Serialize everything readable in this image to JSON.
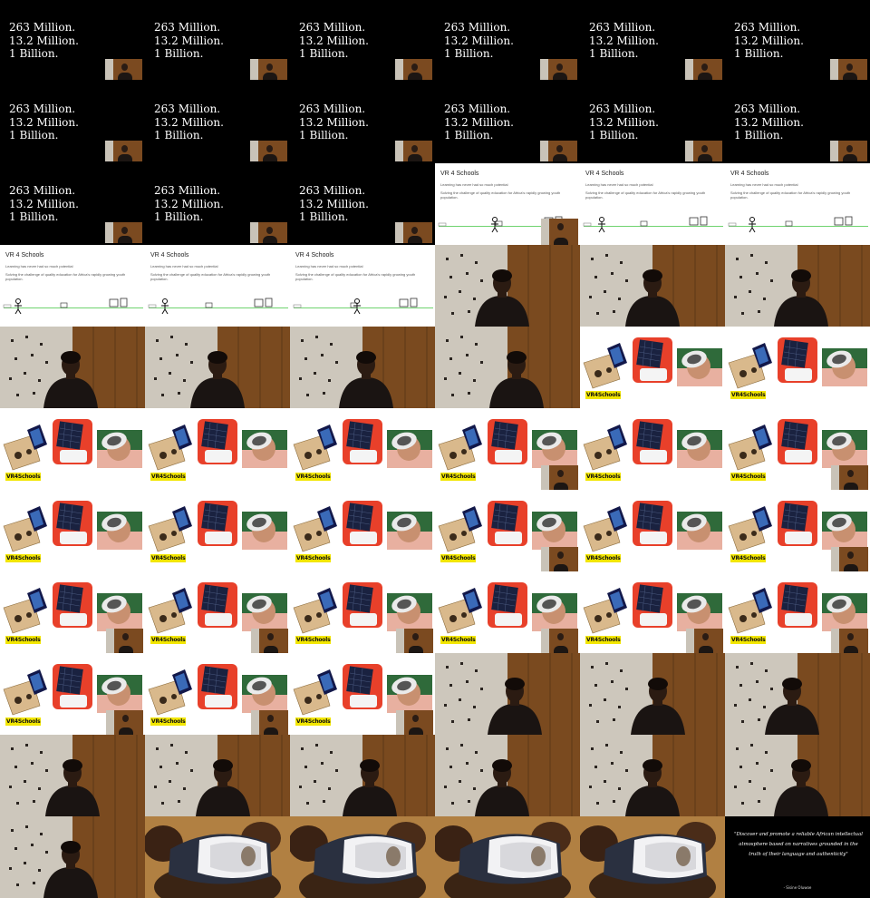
{
  "stats_slide": {
    "lines": [
      "263 Million.",
      "13.2 Million.",
      "1 Billion."
    ]
  },
  "vr_slide": {
    "title": "VR 4 Schools",
    "subtitle": "Learning has never had so much potential",
    "body": "Solving the challenge of quality education for Africa's rapidly growing youth population."
  },
  "product_slide": {
    "tag": "VR4Schools"
  },
  "quote_slide": {
    "quote": "\"Discover and promote a reliable African intellectual atmosphere based on narratives grounded in the truth of their language and authenticity\"",
    "attribution": "- Sisine Oluwoe"
  },
  "colors": {
    "stats_bg": "#000000",
    "vr_line": "#6fd36f",
    "tag_yellow": "#f2e600",
    "wood": "#7a4a1f",
    "wall": "#cdc7bc"
  },
  "frames": [
    "stats",
    "stats",
    "stats",
    "stats",
    "stats",
    "stats",
    "stats",
    "stats",
    "stats",
    "stats",
    "stats",
    "stats",
    "stats",
    "stats",
    "stats",
    "vr",
    "vr",
    "vr",
    "vr",
    "vr",
    "vr",
    "speaker",
    "speaker",
    "speaker",
    "speaker",
    "speaker",
    "speaker",
    "speaker",
    "products",
    "products",
    "products",
    "products",
    "products",
    "products",
    "products",
    "products",
    "products",
    "products",
    "products",
    "products",
    "products",
    "products",
    "products",
    "products",
    "products",
    "products",
    "products",
    "products",
    "products",
    "products",
    "products",
    "speaker",
    "speaker",
    "speaker",
    "speaker",
    "speaker",
    "speaker",
    "speaker",
    "speaker",
    "speaker",
    "speaker",
    "headset",
    "headset",
    "headset",
    "headset",
    "quote"
  ]
}
